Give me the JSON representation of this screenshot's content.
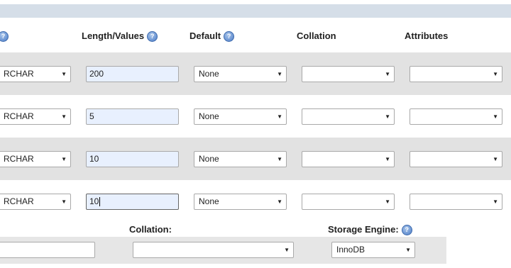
{
  "headers": {
    "length_values": "Length/Values",
    "default": "Default",
    "collation": "Collation",
    "attributes": "Attributes"
  },
  "rows": [
    {
      "type": "RCHAR",
      "length": "200",
      "default": "None",
      "collation": "",
      "attributes": ""
    },
    {
      "type": "RCHAR",
      "length": "5",
      "default": "None",
      "collation": "",
      "attributes": ""
    },
    {
      "type": "RCHAR",
      "length": "10",
      "default": "None",
      "collation": "",
      "attributes": ""
    },
    {
      "type": "RCHAR",
      "length": "10",
      "default": "None",
      "collation": "",
      "attributes": ""
    }
  ],
  "table_options": {
    "collation_label": "Collation:",
    "collation_value": "",
    "storage_engine_label": "Storage Engine:",
    "storage_engine_value": "InnoDB",
    "comments_value": ""
  },
  "icons": {
    "help": "help-icon",
    "dropdown": "chevron-down-icon"
  }
}
